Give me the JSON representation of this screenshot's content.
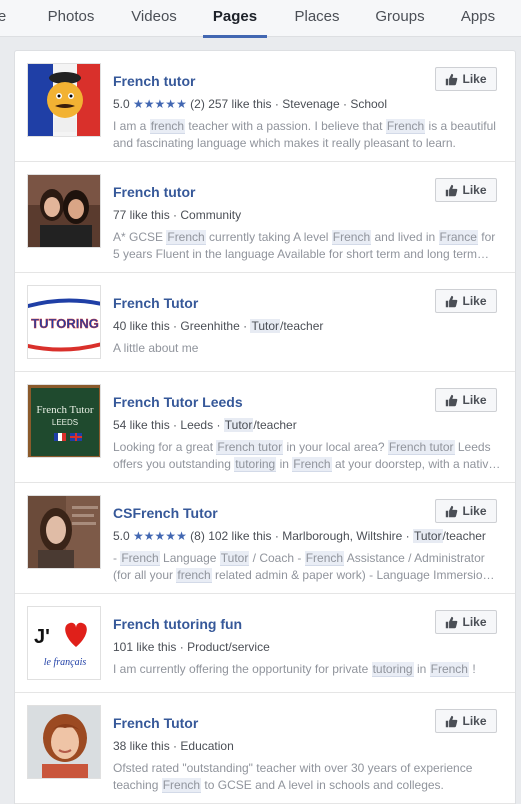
{
  "tabs": [
    {
      "label": "e",
      "active": false
    },
    {
      "label": "Photos",
      "active": false
    },
    {
      "label": "Videos",
      "active": false
    },
    {
      "label": "Pages",
      "active": true
    },
    {
      "label": "Places",
      "active": false
    },
    {
      "label": "Groups",
      "active": false
    },
    {
      "label": "Apps",
      "active": false
    }
  ],
  "like_label": "Like",
  "results": [
    {
      "name": "French tutor",
      "rating": "5.0",
      "stars": "★★★★★",
      "reviews": "(2)",
      "likes": "257 like this",
      "sep1": "·",
      "location": "Stevenage",
      "sep2": "·",
      "category": "School",
      "desc_line1": [
        "I am a ",
        "french",
        " teacher with a passion. I believe that ",
        "French",
        " is a beautiful"
      ],
      "desc_line2": "and fascinating language which makes it really pleasant to learn."
    },
    {
      "name": "French tutor",
      "likes": "77 like this",
      "sep1": "·",
      "category": "Community",
      "desc_line1": [
        "A* GCSE ",
        "French",
        " currently taking A level ",
        "French",
        " and lived in ",
        "France",
        " for"
      ],
      "desc_line2": "5 years Fluent in the language Available for short term and long term…"
    },
    {
      "name": "French Tutor",
      "likes": "40 like this",
      "sep1": "·",
      "location": "Greenhithe",
      "sep2": "·",
      "category_hl": "Tutor",
      "category_rest": "/teacher",
      "desc_line1": "A little about me",
      "logo_text": "TUTORING"
    },
    {
      "name": "French Tutor Leeds",
      "likes": "54 like this",
      "sep1": "·",
      "location": "Leeds",
      "sep2": "·",
      "category_hl": "Tutor",
      "category_rest": "/teacher",
      "desc_line1": [
        "Looking for a great ",
        "French tutor",
        " in your local area? ",
        "French tutor",
        " Leeds"
      ],
      "desc_line2": [
        "offers you outstanding ",
        "tutoring",
        " in ",
        "French",
        " at your doorstep, with a nativ…"
      ],
      "logo_text_1": "French Tutor",
      "logo_text_2": "LEEDS"
    },
    {
      "name": "CSFrench Tutor",
      "rating": "5.0",
      "stars": "★★★★★",
      "reviews": "(8)",
      "likes": "102 like this",
      "sep1": "·",
      "location": "Marlborough, Wiltshire",
      "sep2": "·",
      "category_hl": "Tutor",
      "category_rest": "/teacher",
      "desc_line1": [
        "- ",
        "French",
        " Language ",
        "Tutor",
        " / Coach - ",
        "French",
        " Assistance / Administrator"
      ],
      "desc_line2": [
        "(for all your ",
        "french",
        " related admin & paper work) - Language Immersion…"
      ]
    },
    {
      "name": "French tutoring fun",
      "likes": "101 like this",
      "sep1": "·",
      "category": "Product/service",
      "desc_line1": [
        "I am currently offering the opportunity for private ",
        "tutoring",
        " in ",
        "French",
        " !"
      ],
      "logo_text_1": "J'",
      "logo_text_2": "le français"
    },
    {
      "name": "French Tutor",
      "likes": "38 like this",
      "sep1": "·",
      "category": "Education",
      "desc_line1": "Ofsted rated \"outstanding\" teacher with over 30 years of experience",
      "desc_line2": [
        "teaching ",
        "French",
        " to GCSE and A level in schools and colleges."
      ]
    }
  ],
  "colors": {
    "link": "#365899",
    "accent": "#4267b2",
    "muted": "#90949c"
  }
}
